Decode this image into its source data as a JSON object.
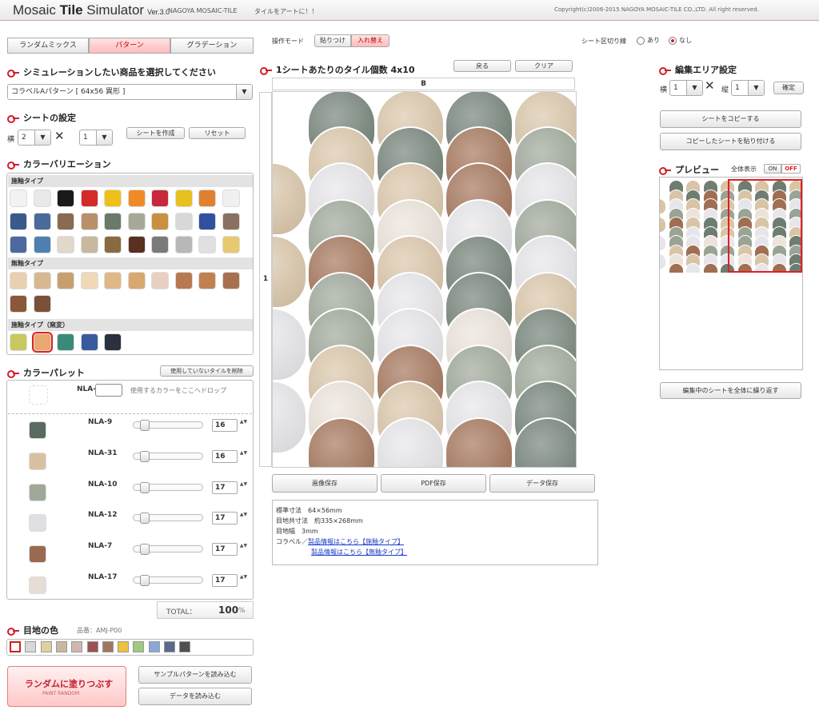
{
  "header": {
    "title_pre": "Mosaic ",
    "title_bold": "Tile",
    "title_post": " Simulator",
    "version": "Ver.3.0",
    "company": "NAGOYA MOSAIC-TILE",
    "slogan": "タイルをアートに！！",
    "copyright": "Copyright(c)2006-2015 NAGOYA MOSAIC-TILE CO.,LTD. All right reserved."
  },
  "tabs": [
    {
      "label": "ランダムミックス"
    },
    {
      "label": "パターン"
    },
    {
      "label": "グラデーション"
    }
  ],
  "product": {
    "heading": "シミュレーションしたい商品を選択してください",
    "selected": "コラベルAパターン [ 64x56 異形 ]"
  },
  "sheet": {
    "heading": "シートの設定",
    "h_label": "横",
    "h_value": "2",
    "v_value": "1",
    "times": "✕",
    "create": "シートを作成",
    "reset": "リセット"
  },
  "variation": {
    "heading": "カラーバリエーション",
    "group1": "施釉タイプ",
    "group2": "無釉タイプ",
    "group3": "施釉タイプ（窯変）",
    "colors1": [
      "#f2f2f2",
      "#e8e8e8",
      "#1a1a1a",
      "#d42a2a",
      "#f0c01a",
      "#f08a28",
      "#c8283c",
      "#e8c020",
      "#e08030",
      "#f0f0f0",
      "#3a5a8a",
      "#4a6a9a",
      "#8a6a50",
      "#b8906a",
      "#6a7a6a",
      "#a8a898",
      "#c89040",
      "#d8d8d8",
      "#3050a0",
      "#8a7060",
      "#4a6aa0",
      "#5080b0",
      "#e0d8c8",
      "#c8b8a0",
      "#8a6a40",
      "#5a3020",
      "#7a7a7a",
      "#b8b8b8",
      "#e0e0e0",
      "#e8c870"
    ],
    "colors2": [
      "#e8d0b0",
      "#d8b890",
      "#c8a070",
      "#f0d8b8",
      "#e0b888",
      "#d8a870",
      "#e8d0c0",
      "#b87850",
      "#c08050",
      "#a87050",
      "#8a5838",
      "#7a5038"
    ],
    "colors3": [
      "#c8c860",
      "#e8a870",
      "#3a8a7a",
      "#3a5aa0",
      "#2a3040"
    ]
  },
  "palette": {
    "heading": "カラーパレット",
    "remove_unused": "使用していないタイルを削除",
    "drop_code": "NLA-",
    "drop_hint": "使用するカラーをここへドロップ",
    "items": [
      {
        "code": "NLA-9",
        "value": "16",
        "color": "#5a6a60"
      },
      {
        "code": "NLA-31",
        "value": "16",
        "color": "#d8c0a0"
      },
      {
        "code": "NLA-10",
        "value": "17",
        "color": "#a0a89a"
      },
      {
        "code": "NLA-12",
        "value": "17",
        "color": "#e0e0e4"
      },
      {
        "code": "NLA-7",
        "value": "17",
        "color": "#9a6a50"
      },
      {
        "code": "NLA-17",
        "value": "17",
        "color": "#e6ddd4"
      }
    ],
    "total_label": "TOTAL：",
    "total_value": "100",
    "total_unit": "%"
  },
  "grout": {
    "heading": "目地の色",
    "code": "品番：AMJ-P00",
    "colors": [
      "#ffffff",
      "#d8d8d8",
      "#e0d0a0",
      "#c8b8a0",
      "#d0b8b0",
      "#a05050",
      "#a07860",
      "#f0c040",
      "#a0c880",
      "#88a8d8",
      "#5a6a8a",
      "#505050"
    ]
  },
  "random": {
    "main": "ランダムに塗りつぶす",
    "sub": "PAINT RANDOM",
    "load_sample": "サンプルパターンを読み込む",
    "load_data": "データを読み込む"
  },
  "mode": {
    "label": "操作モード",
    "paste": "貼りつけ",
    "swap": "入れ替え"
  },
  "divider": {
    "label": "シート区切り線",
    "on": "あり",
    "off": "なし"
  },
  "center": {
    "heading": "1シートあたりのタイル個数",
    "count": "4x10",
    "back": "戻る",
    "clear": "クリア",
    "col_label": "B",
    "row_label": "1",
    "save_image": "画像保存",
    "save_pdf": "PDF保存",
    "save_data": "データ保存"
  },
  "tile_colors": {
    "NLA-9": "#6e7d72",
    "NLA-31": "#d9c4a6",
    "NLA-10": "#9aa394",
    "NLA-12": "#e6e6ea",
    "NLA-7": "#a06e52",
    "NLA-17": "#ece3da"
  },
  "tile_grid": [
    [
      "NLA-9",
      "NLA-31",
      "NLA-9",
      "NLA-31"
    ],
    [
      "NLA-31",
      "NLA-9",
      "NLA-7",
      "NLA-10"
    ],
    [
      "NLA-31",
      "NLA-12",
      "NLA-31",
      "NLA-7",
      "NLA-12"
    ],
    [
      "NLA-10",
      "NLA-17",
      "NLA-12",
      "NLA-10"
    ],
    [
      "NLA-31",
      "NLA-7",
      "NLA-31",
      "NLA-9",
      "NLA-12"
    ],
    [
      "NLA-10",
      "NLA-12",
      "NLA-9",
      "NLA-31"
    ],
    [
      "NLA-12",
      "NLA-10",
      "NLA-12",
      "NLA-17",
      "NLA-9"
    ],
    [
      "NLA-31",
      "NLA-7",
      "NLA-10",
      "NLA-10"
    ],
    [
      "NLA-12",
      "NLA-17",
      "NLA-31",
      "NLA-12",
      "NLA-9"
    ],
    [
      "NLA-7",
      "NLA-12",
      "NLA-7",
      "NLA-9"
    ]
  ],
  "info": {
    "size": "標準寸法　64×56mm",
    "sheet": "目地共寸法　約335×268mm",
    "joint": "目地幅　3mm",
    "brand": "コラベル／",
    "link1": "製品情報はこちら【施釉タイプ】",
    "link2": "製品情報はこちら【無釉タイプ】"
  },
  "edit": {
    "heading": "編集エリア設定",
    "h_label": "横",
    "h_value": "1",
    "v_value": "1",
    "confirm": "確定",
    "copy": "シートをコピーする",
    "paste": "コピーしたシートを貼り付ける",
    "preview": "プレビュー",
    "whole": "全体表示",
    "on": "ON",
    "off": "OFF",
    "repeat": "編集中のシートを全体に繰り返す"
  }
}
